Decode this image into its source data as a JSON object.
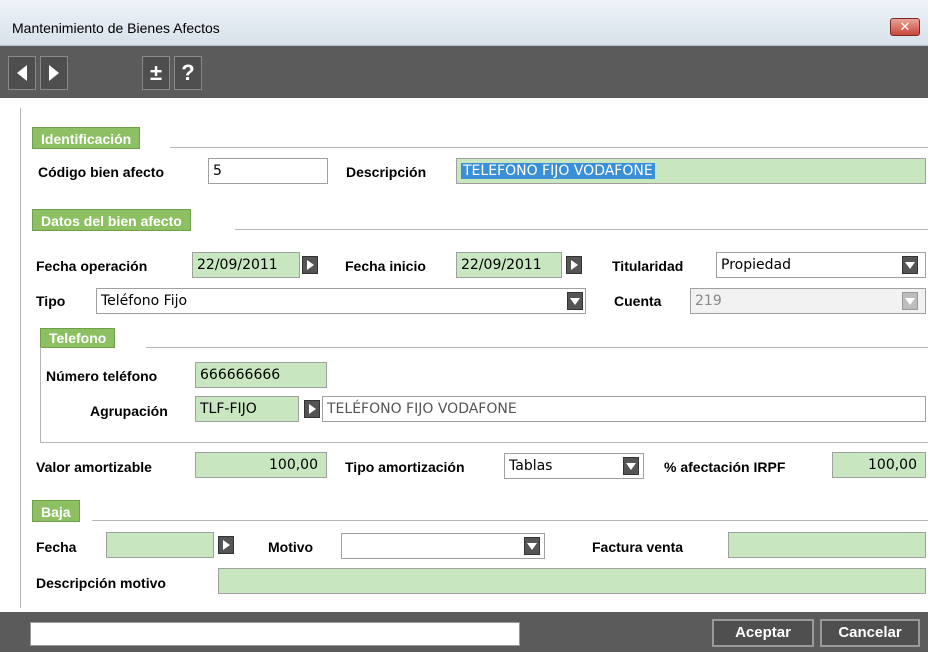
{
  "window": {
    "title": "Mantenimiento de Bienes Afectos",
    "close_glyph": "✕"
  },
  "toolbar": {
    "buttons": [
      {
        "icon": "arrow-left-icon"
      },
      {
        "icon": "arrow-right-icon"
      },
      {
        "icon": "plus-minus-icon",
        "glyph": "±"
      },
      {
        "icon": "help-icon",
        "glyph": "?"
      }
    ]
  },
  "identificacion": {
    "title": "Identificación",
    "codigo_label": "Código bien afecto",
    "codigo_value": "5",
    "descripcion_label": "Descripción",
    "descripcion_value": "TELEFONO FIJO VODAFONE"
  },
  "datos": {
    "title": "Datos del bien afecto",
    "fecha_operacion_label": "Fecha operación",
    "fecha_operacion_value": "22/09/2011",
    "fecha_inicio_label": "Fecha inicio",
    "fecha_inicio_value": "22/09/2011",
    "titularidad_label": "Titularidad",
    "titularidad_value": "Propiedad",
    "tipo_label": "Tipo",
    "tipo_value": "Teléfono Fijo",
    "cuenta_label": "Cuenta",
    "cuenta_value": "219",
    "valor_label": "Valor amortizable",
    "valor_value": "100,00",
    "tipo_amort_label": "Tipo amortización",
    "tipo_amort_value": "Tablas",
    "afectacion_label": "% afectación IRPF",
    "afectacion_value": "100,00"
  },
  "telefono": {
    "title": "Telefono",
    "numero_label": "Número teléfono",
    "numero_value": "666666666",
    "agrupacion_label": "Agrupación",
    "agrupacion_code": "TLF-FIJO",
    "agrupacion_desc": "TELÉFONO FIJO VODAFONE"
  },
  "baja": {
    "title": "Baja",
    "fecha_label": "Fecha",
    "fecha_value": "",
    "motivo_label": "Motivo",
    "motivo_value": "",
    "factura_label": "Factura venta",
    "factura_value": "",
    "desc_motivo_label": "Descripción motivo",
    "desc_motivo_value": ""
  },
  "footer": {
    "status_text": "",
    "aceptar_label": "Aceptar",
    "cancelar_label": "Cancelar"
  },
  "colors": {
    "section_green": "#8dc063",
    "field_green": "#c8e6c0",
    "selection_blue": "#3b8fd6",
    "toolbar_grey": "#5b5b5b"
  }
}
